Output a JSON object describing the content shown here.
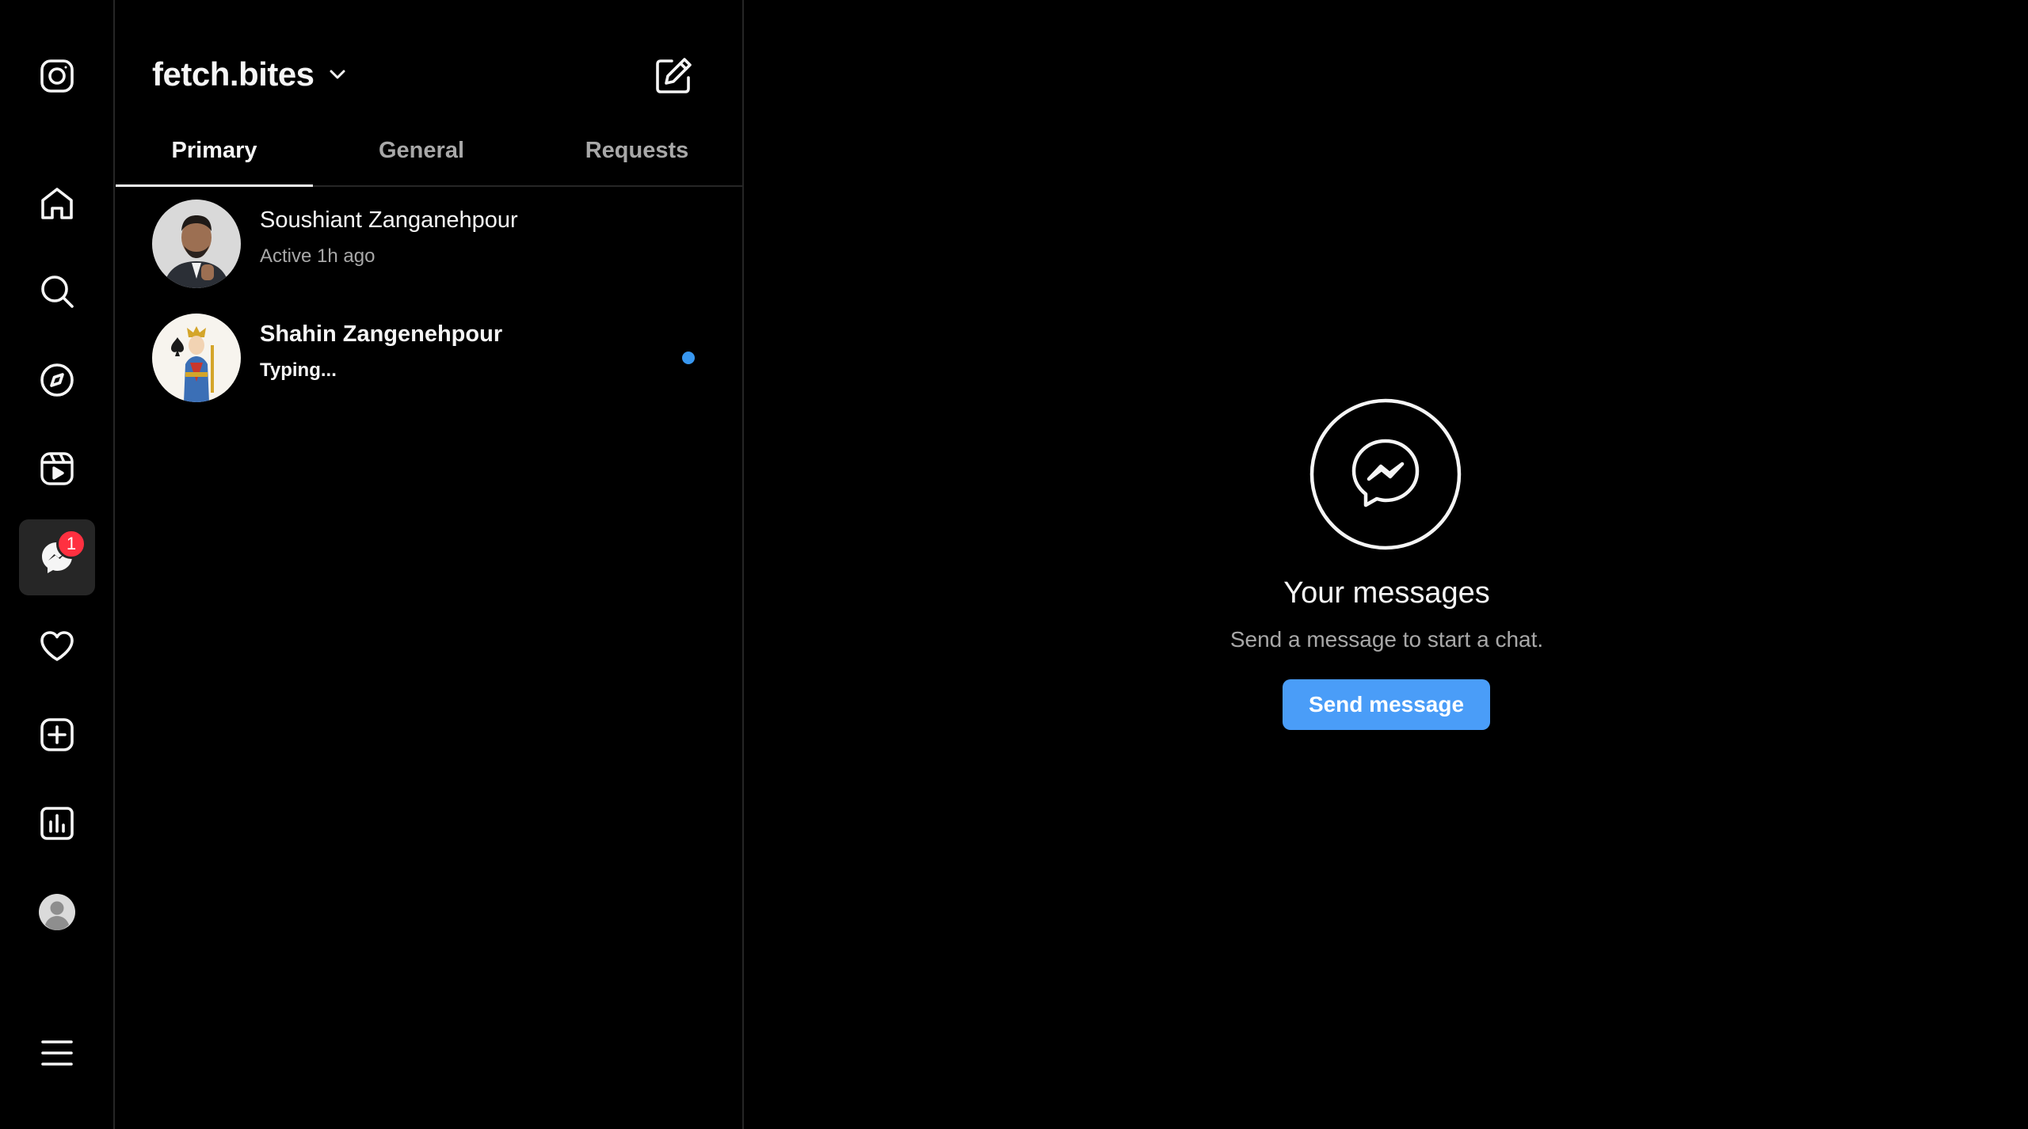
{
  "nav": {
    "items": [
      {
        "name": "instagram-logo-icon"
      },
      {
        "name": "home-icon"
      },
      {
        "name": "search-icon"
      },
      {
        "name": "explore-compass-icon"
      },
      {
        "name": "reels-icon"
      },
      {
        "name": "messenger-icon",
        "badge": "1",
        "active": true
      },
      {
        "name": "heart-notifications-icon"
      },
      {
        "name": "create-plus-icon"
      },
      {
        "name": "insights-chart-icon"
      },
      {
        "name": "profile-avatar-icon"
      },
      {
        "name": "menu-hamburger-icon"
      }
    ],
    "badge_count": "1"
  },
  "inbox": {
    "account_name": "fetch.bites",
    "tabs": [
      {
        "label": "Primary",
        "active": true
      },
      {
        "label": "General"
      },
      {
        "label": "Requests"
      }
    ],
    "threads": [
      {
        "name": "Soushiant Zanganehpour",
        "status": "Active 1h ago",
        "unread": false
      },
      {
        "name": "Shahin Zangenehpour",
        "status": "Typing...",
        "unread": true
      }
    ]
  },
  "empty_state": {
    "title": "Your messages",
    "subtitle": "Send a message to start a chat.",
    "button_label": "Send message"
  },
  "colors": {
    "background": "#000000",
    "accent": "#4a9df8",
    "badge": "#ff3040",
    "divider": "#262626",
    "secondary_text": "#a8a8a8"
  }
}
